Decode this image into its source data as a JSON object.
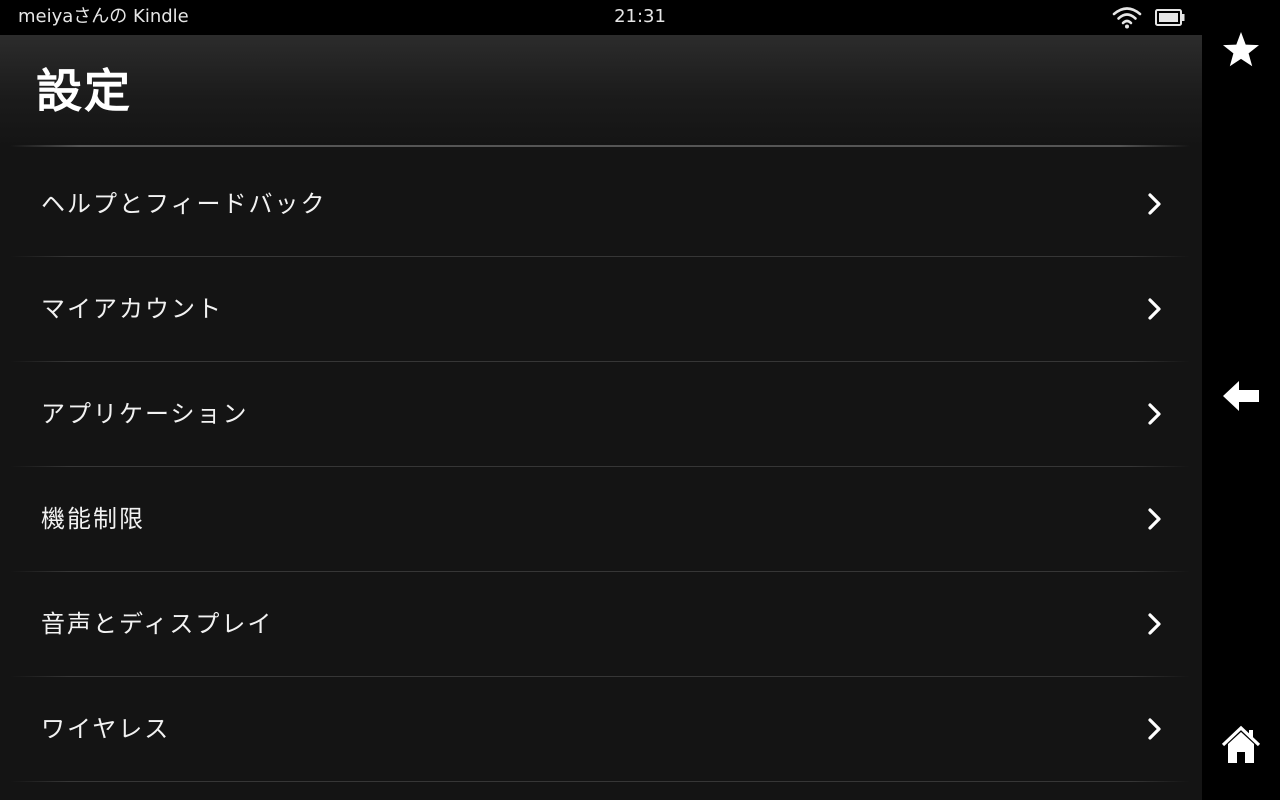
{
  "status_bar": {
    "device_name": "meiyaさんの Kindle",
    "time": "21:31",
    "wifi_icon": "wifi-icon",
    "battery_icon": "battery-icon"
  },
  "header": {
    "title": "設定"
  },
  "settings": {
    "items": [
      {
        "label": "ヘルプとフィードバック",
        "icon": "chevron-right-icon"
      },
      {
        "label": "マイアカウント",
        "icon": "chevron-right-icon"
      },
      {
        "label": "アプリケーション",
        "icon": "chevron-right-icon"
      },
      {
        "label": "機能制限",
        "icon": "chevron-right-icon"
      },
      {
        "label": "音声とディスプレイ",
        "icon": "chevron-right-icon"
      },
      {
        "label": "ワイヤレス",
        "icon": "chevron-right-icon"
      }
    ]
  },
  "nav_bar": {
    "favorites_icon": "star-icon",
    "back_icon": "back-arrow-icon",
    "home_icon": "home-icon"
  },
  "colors": {
    "background": "#141414",
    "status_bar": "#000000",
    "text": "#f2f2f2",
    "divider": "#363636"
  }
}
